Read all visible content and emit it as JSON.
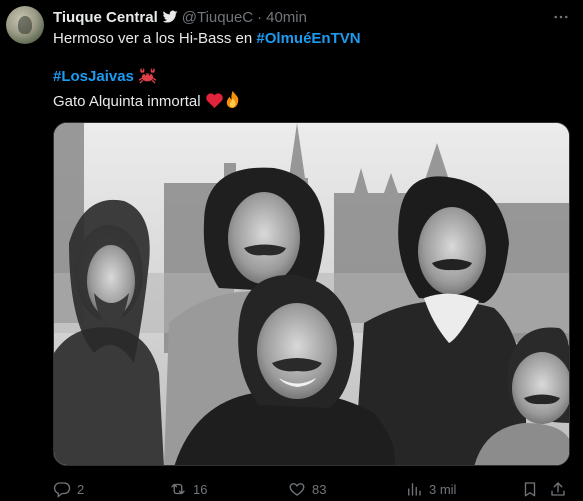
{
  "tweet": {
    "author": {
      "display_name": "Tiuque Central",
      "handle": "@TiuqueC",
      "separator": "·",
      "time": "40min",
      "verified_icon": "twitter-bird-icon"
    },
    "body": {
      "line1_prefix": "Hermoso ver a los Hi-Bass en ",
      "hashtag1": "#OlmuéEnTVN",
      "hashtag2": "#LosJaivas",
      "hashtag2_emoji": "crab-emoji",
      "line3_text": "Gato Alquinta inmortal",
      "line3_emojis": [
        "red-heart-emoji",
        "fire-emoji"
      ]
    },
    "media": {
      "type": "black-and-white band photo",
      "people_count": 5
    },
    "actions": {
      "replies": "2",
      "retweets": "16",
      "likes": "83",
      "views": "3 mil"
    }
  },
  "colors": {
    "background": "#000000",
    "text": "#e7e9ea",
    "muted": "#71767b",
    "link": "#1d9bf0"
  }
}
